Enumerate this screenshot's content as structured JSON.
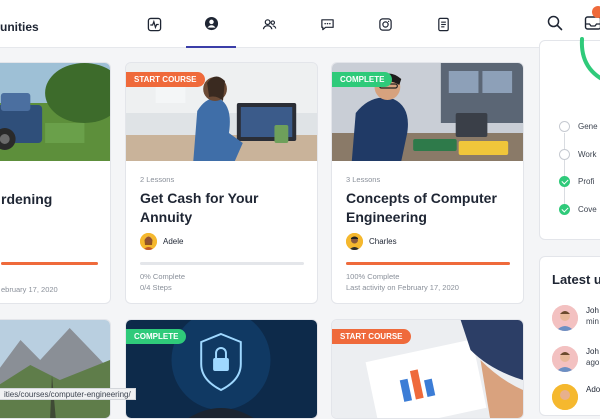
{
  "header": {
    "brand": "unities",
    "nav_icons": [
      "activity-icon",
      "profile-icon",
      "people-icon",
      "chat-icon",
      "camera-icon",
      "document-icon"
    ],
    "active_nav": "profile-icon",
    "right_icons": [
      "search-icon",
      "inbox-icon"
    ]
  },
  "courses": [
    {
      "title": "rdening",
      "date": "ebruary 17, 2020",
      "progress": 0.7
    },
    {
      "tag": "START COURSE",
      "lessons": "2 Lessons",
      "title": "Get Cash for Your Annuity",
      "author": "Adele",
      "complete": "0% Complete",
      "steps": "0/4 Steps",
      "progress": 0
    },
    {
      "tag": "COMPLETE",
      "lessons": "3 Lessons",
      "title": "Concepts of Computer Engineering",
      "author": "Charles",
      "complete": "100% Complete",
      "activity": "Last activity on February 17, 2020",
      "progress": 1
    },
    {
      "tag": "COMPLETE"
    },
    {
      "tag": "START COURSE"
    }
  ],
  "profile_checklist": [
    {
      "label": "Gene",
      "done": false
    },
    {
      "label": "Work",
      "done": false
    },
    {
      "label": "Profi",
      "done": true
    },
    {
      "label": "Cove",
      "done": true
    }
  ],
  "latest": {
    "title": "Latest u",
    "items": [
      {
        "line1": "Joh",
        "line2": "min"
      },
      {
        "line1": "Joh",
        "line2": "ago"
      },
      {
        "line1": "Ado",
        "line2": ""
      }
    ]
  },
  "status_url": "ities/courses/computer-engineering/",
  "colors": {
    "accent_orange": "#ef6a3b",
    "accent_green": "#2fca7a",
    "nav_active": "#3b3ea8"
  }
}
